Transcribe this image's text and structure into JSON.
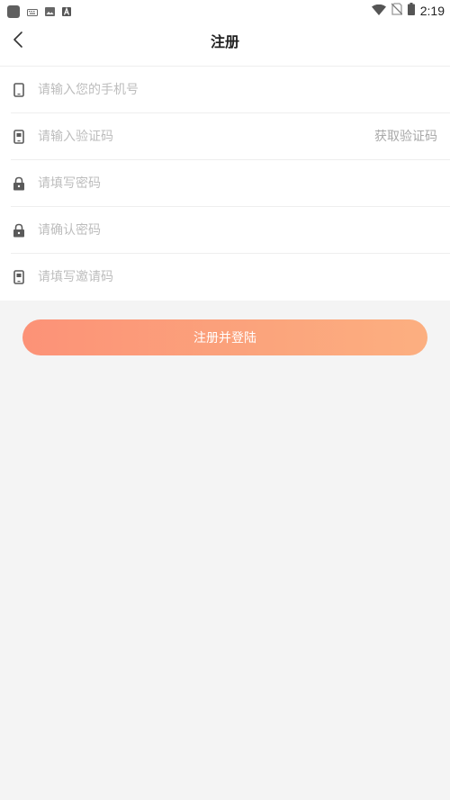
{
  "status_bar": {
    "time": "2:19",
    "icons": [
      "app-square-icon",
      "keyboard-icon",
      "image-icon",
      "font-a-icon",
      "wifi-icon",
      "no-sim-icon",
      "battery-icon"
    ]
  },
  "header": {
    "title": "注册",
    "back_icon": "chevron-left-icon"
  },
  "form": {
    "phone": {
      "placeholder": "请输入您的手机号",
      "value": "",
      "icon": "phone-icon"
    },
    "code": {
      "placeholder": "请输入验证码",
      "value": "",
      "icon": "sms-phone-icon",
      "action_label": "获取验证码"
    },
    "password": {
      "placeholder": "请填写密码",
      "value": "",
      "icon": "lock-icon"
    },
    "confirm_password": {
      "placeholder": "请确认密码",
      "value": "",
      "icon": "lock-icon"
    },
    "invite_code": {
      "placeholder": "请填写邀请码",
      "value": "",
      "icon": "sms-phone-icon"
    }
  },
  "submit": {
    "label": "注册并登陆"
  },
  "colors": {
    "accent_start": "#fc9277",
    "accent_end": "#fcaf80",
    "background": "#f4f4f4",
    "placeholder": "#bdbdbd"
  }
}
